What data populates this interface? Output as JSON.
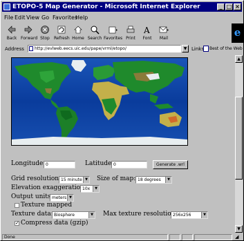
{
  "window": {
    "title": "ETOPO-5 Map Generator - Microsoft Internet Explorer"
  },
  "menu": [
    "File",
    "Edit",
    "View",
    "Go",
    "Favorites",
    "Help"
  ],
  "toolbar": [
    {
      "label": "Back",
      "icon": "back-arrow-icon"
    },
    {
      "label": "Forward",
      "icon": "forward-arrow-icon"
    },
    {
      "label": "Stop",
      "icon": "stop-icon"
    },
    {
      "label": "Refresh",
      "icon": "refresh-icon"
    },
    {
      "label": "Home",
      "icon": "home-icon"
    },
    {
      "label": "Search",
      "icon": "search-icon"
    },
    {
      "label": "Favorites",
      "icon": "favorites-icon"
    },
    {
      "label": "Print",
      "icon": "print-icon"
    },
    {
      "label": "Font",
      "icon": "font-icon"
    },
    {
      "label": "Mail",
      "icon": "mail-icon"
    }
  ],
  "address": {
    "label": "Address",
    "url": "http://evlweb.eecs.uic.edu/pape/vrml/etopo/"
  },
  "links": {
    "label": "Links",
    "item": "Best of the Web"
  },
  "form": {
    "longitude_label": "Longitude:",
    "longitude_value": "0",
    "latitude_label": "Latitude:",
    "latitude_value": "0",
    "generate_label": "Generate .wrl",
    "grid_resolution_label": "Grid resolution:",
    "grid_resolution_value": "15 minute",
    "size_of_map_label": "Size of map:",
    "size_of_map_value": "18 degrees",
    "elevation_label": "Elevation exaggeration:",
    "elevation_value": "10x",
    "output_units_label": "Output units:",
    "output_units_value": "meters",
    "texture_mapped_label": "Texture mapped",
    "texture_mapped_checked": false,
    "texture_data_label": "Texture data:",
    "texture_data_value": "Biosphere",
    "max_texture_label": "Max texture resolution:",
    "max_texture_value": "256x256",
    "compress_label": "Compress data (gzip)",
    "compress_checked": true
  },
  "status": {
    "text": "Done"
  },
  "colors": {
    "titlebar": "#000080",
    "ocean": "#0b3f9e",
    "land": "#1f8a2c",
    "ice": "#e8eef0"
  }
}
